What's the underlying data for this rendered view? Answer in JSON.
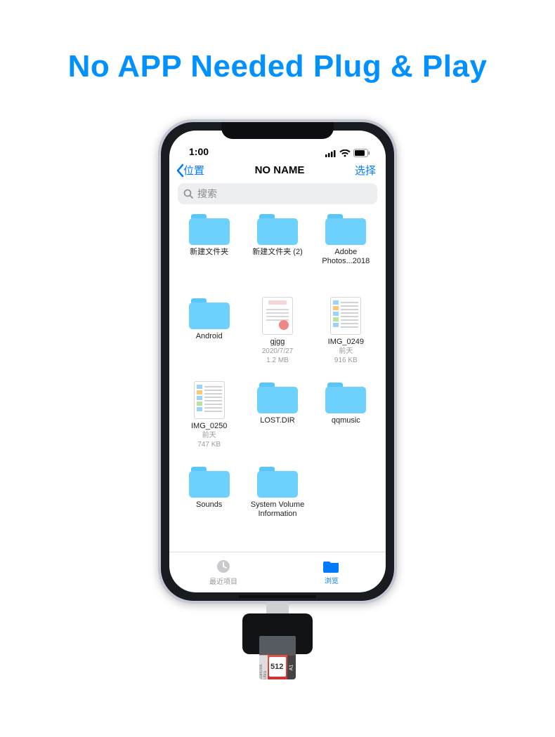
{
  "headline": "No APP Needed Plug & Play",
  "status": {
    "time": "1:00"
  },
  "nav": {
    "back_label": "位置",
    "title": "NO NAME",
    "select_label": "选择"
  },
  "search": {
    "placeholder": "搜索"
  },
  "files": [
    {
      "name": "新建文件夹",
      "type": "folder"
    },
    {
      "name": "新建文件夹 (2)",
      "type": "folder"
    },
    {
      "name": "Adobe Photos...2018",
      "type": "folder"
    },
    {
      "name": "Android",
      "type": "folder"
    },
    {
      "name": "gjgg",
      "type": "doc",
      "meta1": "2020/7/27",
      "meta2": "1.2 MB"
    },
    {
      "name": "IMG_0249",
      "type": "screenshot",
      "meta1": "前天",
      "meta2": "916 KB"
    },
    {
      "name": "IMG_0250",
      "type": "screenshot",
      "meta1": "前天",
      "meta2": "747 KB"
    },
    {
      "name": "LOST.DIR",
      "type": "folder"
    },
    {
      "name": "qqmusic",
      "type": "folder"
    },
    {
      "name": "Sounds",
      "type": "folder"
    },
    {
      "name": "System Volume Information",
      "type": "folder"
    }
  ],
  "tabs": {
    "recent": "最近项目",
    "browse": "浏览"
  },
  "sd": {
    "brand": "SanDisk Ultra",
    "capacity": "512",
    "spec": "A1"
  }
}
